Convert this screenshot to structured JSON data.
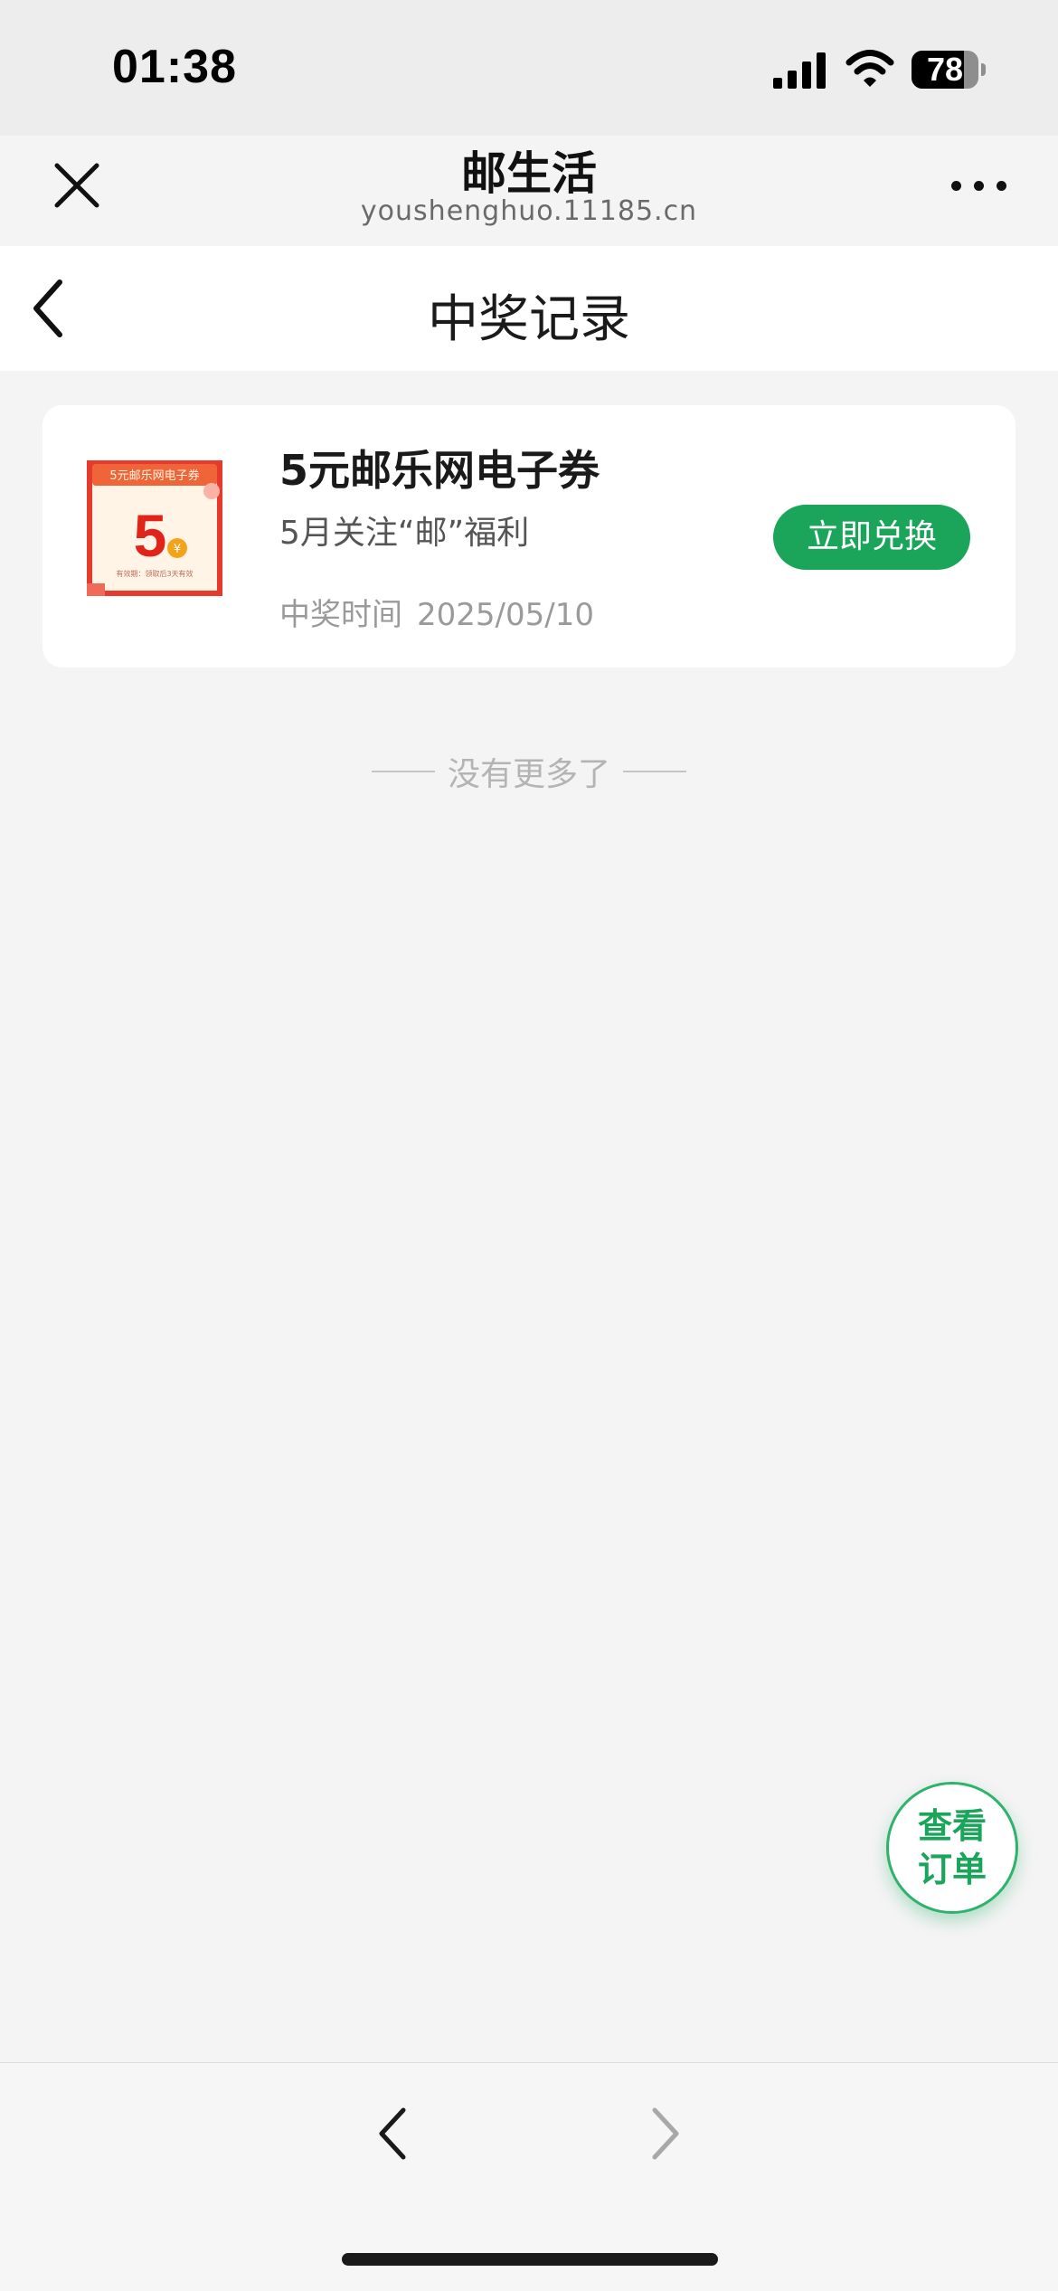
{
  "status_bar": {
    "time": "01:38",
    "battery_level": "78",
    "icons": [
      "signal-icon",
      "wifi-icon",
      "battery-icon"
    ]
  },
  "mini_program": {
    "title": "邮生活",
    "url": "youshenghuo.11185.cn",
    "icons": [
      "close-icon",
      "more-icon"
    ]
  },
  "page": {
    "title": "中奖记录",
    "icons": [
      "back-icon"
    ]
  },
  "prizes": [
    {
      "name": "5元邮乐网电子券",
      "campaign": "5月关注“邮”福利",
      "time_label": "中奖时间",
      "time_value": "2025/05/10",
      "action_label": "立即兑换",
      "thumb": {
        "header": "5元邮乐网电子券",
        "amount": "5",
        "currency": "¥",
        "footer": "有效期：领取后3天有效"
      }
    }
  ],
  "list_end_text": "没有更多了",
  "floating_button": {
    "line1": "查看",
    "line2": "订单"
  },
  "bottom_nav": {
    "icons": [
      "nav-back-icon",
      "nav-forward-icon"
    ]
  },
  "colors": {
    "accent_green": "#1aa55b",
    "background": "#f4f4f4",
    "coupon_red": "#e53a2c"
  }
}
